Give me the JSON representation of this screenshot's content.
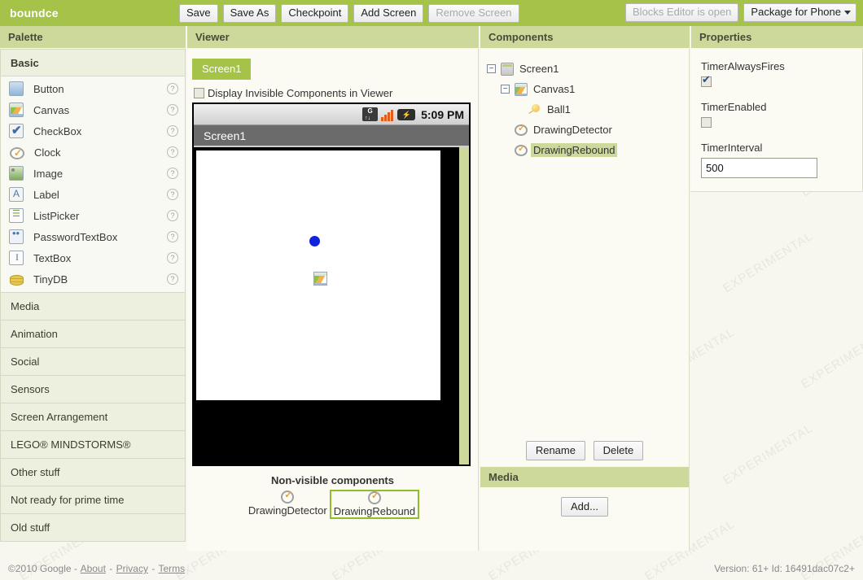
{
  "topbar": {
    "project_title": "boundce",
    "buttons": [
      {
        "label": "Save",
        "disabled": false
      },
      {
        "label": "Save As",
        "disabled": false
      },
      {
        "label": "Checkpoint",
        "disabled": false
      },
      {
        "label": "Add Screen",
        "disabled": false
      },
      {
        "label": "Remove Screen",
        "disabled": true
      }
    ],
    "blocks_editor_label": "Blocks Editor is open",
    "package_label": "Package for Phone"
  },
  "column_headers": {
    "palette": "Palette",
    "viewer": "Viewer",
    "components": "Components",
    "properties": "Properties"
  },
  "palette": {
    "open_section": "Basic",
    "basic_items": [
      {
        "label": "Button",
        "icon": "button-icon",
        "help": "?"
      },
      {
        "label": "Canvas",
        "icon": "canvas-icon",
        "help": "?"
      },
      {
        "label": "CheckBox",
        "icon": "checkbox-icon",
        "help": "?"
      },
      {
        "label": "Clock",
        "icon": "clock-icon",
        "help": "?"
      },
      {
        "label": "Image",
        "icon": "image-icon",
        "help": "?"
      },
      {
        "label": "Label",
        "icon": "label-icon",
        "help": "?"
      },
      {
        "label": "ListPicker",
        "icon": "listpicker-icon",
        "help": "?"
      },
      {
        "label": "PasswordTextBox",
        "icon": "passwordtextbox-icon",
        "help": "?"
      },
      {
        "label": "TextBox",
        "icon": "textbox-icon",
        "help": "?"
      },
      {
        "label": "TinyDB",
        "icon": "tinydb-icon",
        "help": "?"
      }
    ],
    "sections": [
      "Media",
      "Animation",
      "Social",
      "Sensors",
      "Screen Arrangement",
      "LEGO® MINDSTORMS®",
      "Other stuff",
      "Not ready for prime time",
      "Old stuff"
    ]
  },
  "viewer": {
    "screen_tab": "Screen1",
    "invisible_checkbox_label": "Display Invisible Components in Viewer",
    "invisible_checkbox_checked": false,
    "phone": {
      "status_time": "5:09 PM",
      "status_icons": [
        "data-transfer-icon",
        "signal-bars-icon",
        "battery-icon"
      ],
      "data_icon_letter": "G",
      "battery_glyph": "⚡",
      "title": "Screen1"
    },
    "nonvisible_title": "Non-visible components",
    "nonvisible_items": [
      {
        "label": "DrawingDetector",
        "selected": false,
        "icon": "clock-icon"
      },
      {
        "label": "DrawingRebound",
        "selected": true,
        "icon": "clock-icon"
      }
    ]
  },
  "components": {
    "tree": [
      {
        "label": "Screen1",
        "depth": 0,
        "toggle": "−",
        "icon": "screen-icon",
        "selected": false
      },
      {
        "label": "Canvas1",
        "depth": 1,
        "toggle": "−",
        "icon": "canvas-icon",
        "selected": false
      },
      {
        "label": "Ball1",
        "depth": 2,
        "toggle": "",
        "icon": "ball-icon",
        "selected": false
      },
      {
        "label": "DrawingDetector",
        "depth": 1,
        "toggle": "",
        "icon": "clock-icon",
        "selected": false
      },
      {
        "label": "DrawingRebound",
        "depth": 1,
        "toggle": "",
        "icon": "clock-icon",
        "selected": true
      }
    ],
    "rename_label": "Rename",
    "delete_label": "Delete",
    "media_header": "Media",
    "media_add_label": "Add..."
  },
  "properties": {
    "items": [
      {
        "label": "TimerAlwaysFires",
        "type": "checkbox",
        "checked": true
      },
      {
        "label": "TimerEnabled",
        "type": "checkbox",
        "checked": false
      },
      {
        "label": "TimerInterval",
        "type": "text",
        "value": "500"
      }
    ]
  },
  "footer": {
    "copyright": "©2010 Google -",
    "about": "About",
    "sep1": "-",
    "privacy": "Privacy",
    "sep2": "-",
    "terms": "Terms",
    "version": "Version: 61+ Id: 16491dac07c2+"
  },
  "watermark_text": "EXPERIMENTAL",
  "colors": {
    "brand_green": "#a5c249",
    "header_green": "#ccd99a",
    "panel_bg": "#fbfbf3",
    "palette_section_bg": "#edf0df",
    "ball_blue": "#1122dd",
    "selection_green": "#8fbe2a"
  }
}
